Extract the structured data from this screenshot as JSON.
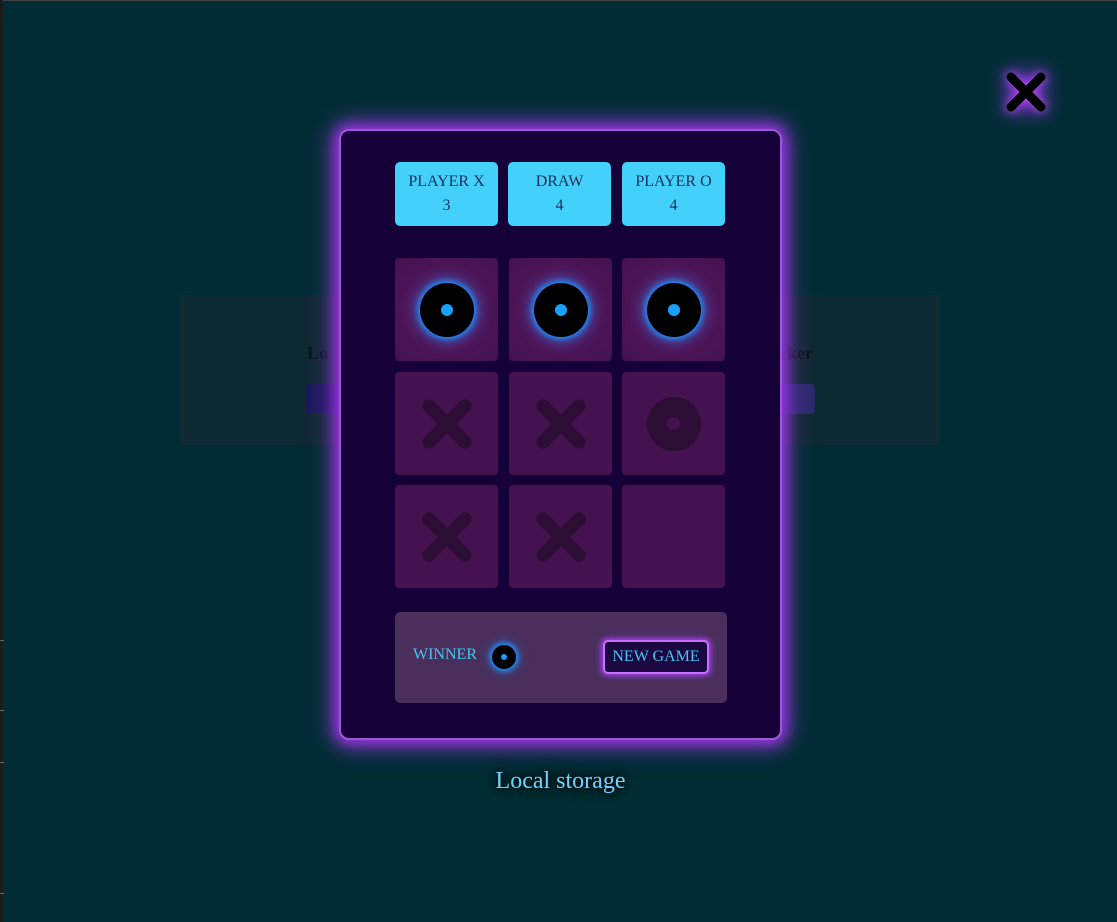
{
  "background_page": {
    "left_label": "Lo",
    "right_label": "rker"
  },
  "scoreboard": [
    {
      "label": "PLAYER X",
      "value": "3"
    },
    {
      "label": "DRAW",
      "value": "4"
    },
    {
      "label": "PLAYER O",
      "value": "4"
    }
  ],
  "board": [
    [
      "o-win",
      "o-win",
      "o-win"
    ],
    [
      "x",
      "x",
      "o"
    ],
    [
      "x",
      "x",
      "empty"
    ]
  ],
  "status": {
    "winner_label": "WINNER",
    "winner_symbol": "o",
    "new_game_label": "NEW GAME"
  },
  "footer": {
    "title": "Local storage"
  },
  "colors": {
    "page_bg": "#002d33",
    "modal_bg": "#150038",
    "modal_glow": "#9d35e8",
    "score_bg": "#43d0fb",
    "cell_bg": "#44124f",
    "win_glow": "#1e90ff",
    "text_accent": "#43c6f2"
  }
}
